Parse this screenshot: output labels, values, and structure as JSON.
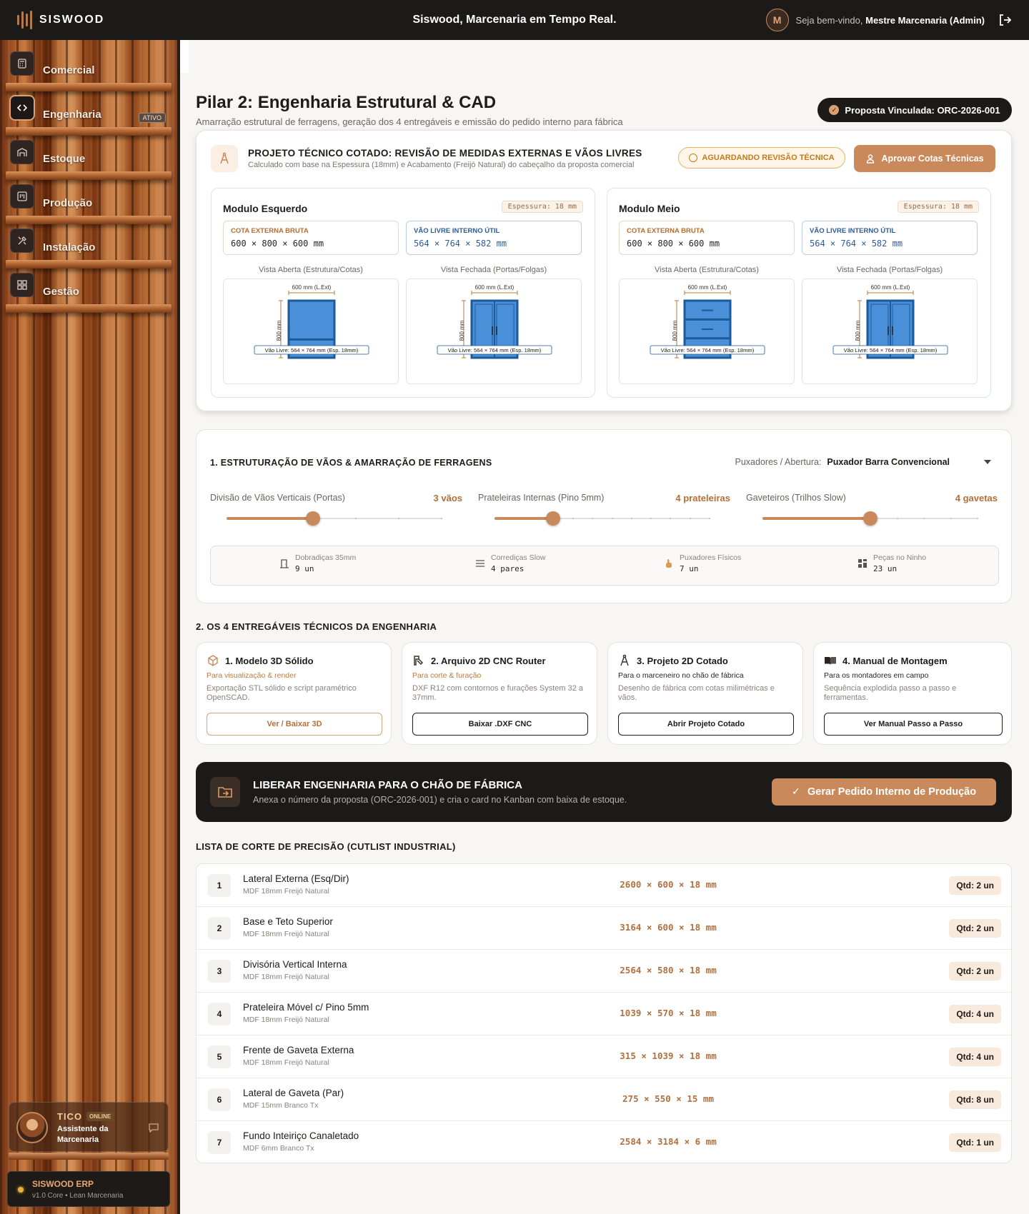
{
  "topbar": {
    "logo": "SISWOOD",
    "title": "Siswood, Marcenaria em Tempo Real.",
    "avatar_initial": "M",
    "welcome": "Seja bem-vindo,",
    "user": "Mestre Marcenaria (Admin)"
  },
  "sidebar": {
    "items": [
      {
        "label": "Comercial",
        "icon": "calculator-icon"
      },
      {
        "label": "Engenharia",
        "icon": "code-icon",
        "active": true,
        "badge": "ATIVO"
      },
      {
        "label": "Estoque",
        "icon": "warehouse-icon"
      },
      {
        "label": "Produção",
        "icon": "kanban-icon"
      },
      {
        "label": "Instalação",
        "icon": "tools-icon"
      },
      {
        "label": "Gestão",
        "icon": "dashboard-icon"
      }
    ],
    "assistant": {
      "name": "TICO",
      "status": "ONLINE",
      "subtitle": "Assistente da Marcenaria"
    },
    "erp": {
      "name": "SISWOOD ERP",
      "version": "v1.0 Core • Lean Marcenaria"
    }
  },
  "header": {
    "title": "Pilar 2: Engenharia Estrutural & CAD",
    "subtitle": "Amarração estrutural de ferragens, geração dos 4 entregáveis e emissão do pedido interno para fábrica",
    "proposal": "Proposta Vinculada: ORC-2026-001"
  },
  "project": {
    "title": "PROJETO TÉCNICO COTADO: REVISÃO DE MEDIDAS EXTERNAS E VÃOS LIVRES",
    "subtitle": "Calculado com base na Espessura (18mm) e Acabamento (Freijó Natural) do cabeçalho da proposta comercial",
    "status": "AGUARDANDO REVISÃO TÉCNICA",
    "approve_label": "Aprovar Cotas Técnicas",
    "cota_ext_label": "COTA EXTERNA BRUTA",
    "vao_label": "VÃO LIVRE INTERNO ÚTIL",
    "vista_aberta": "Vista Aberta (Estrutura/Cotas)",
    "vista_fechada": "Vista Fechada (Portas/Folgas)",
    "width_label": "600 mm (L.Ext)",
    "height_label": "800 mm",
    "vao_caption": "Vão Livre: 564 × 764 mm (Esp. 18mm)",
    "modules": [
      {
        "name": "Modulo Esquerdo",
        "espessura": "Espessura: 18 mm",
        "cota_ext": "600 × 800 × 600 mm",
        "vao": "564 × 764 × 582 mm",
        "open_type": "shelf"
      },
      {
        "name": "Modulo Meio",
        "espessura": "Espessura: 18 mm",
        "cota_ext": "600 × 800 × 600 mm",
        "vao": "564 × 764 × 582 mm",
        "open_type": "drawers"
      }
    ],
    "colors": {
      "blue": "#4a90d9",
      "frame": "#1d5a9a",
      "wood": "#b5793f"
    }
  },
  "structure": {
    "title": "1. ESTRUTURAÇÃO DE VÃOS & AMARRAÇÃO DE FERRAGENS",
    "puxadores_label": "Puxadores / Abertura:",
    "puxadores_value": "Puxador Barra Convencional",
    "sliders": [
      {
        "label": "Divisão de Vãos Verticais (Portas)",
        "value_text": "3 vãos",
        "value": 3,
        "min": 1,
        "max": 6
      },
      {
        "label": "Prateleiras Internas (Pino 5mm)",
        "value_text": "4 prateleiras",
        "value": 4,
        "min": 1,
        "max": 12
      },
      {
        "label": "Gaveteiros (Trilhos Slow)",
        "value_text": "4 gavetas",
        "value": 4,
        "min": 0,
        "max": 8
      }
    ],
    "hardware": [
      {
        "label": "Dobradiças 35mm",
        "value": "9 un",
        "icon": "door-icon"
      },
      {
        "label": "Corrediças Slow",
        "value": "4 pares",
        "icon": "rails-icon"
      },
      {
        "label": "Puxadores Físicos",
        "value": "7 un",
        "icon": "hand-icon"
      },
      {
        "label": "Peças no Ninho",
        "value": "23 un",
        "icon": "grid-icon"
      }
    ]
  },
  "deliverables": {
    "title": "2. OS 4 ENTREGÁVEIS TÉCNICOS DA ENGENHARIA",
    "items": [
      {
        "title": "1. Modelo 3D Sólido",
        "tag": "Para visualização & render",
        "desc": "Exportação STL sólido e script paramétrico OpenSCAD.",
        "button": "Ver / Baixar 3D"
      },
      {
        "title": "2. Arquivo 2D CNC Router",
        "tag": "Para corte & furação",
        "desc": "DXF R12 com contornos e furações System 32 a 37mm.",
        "button": "Baixar .DXF CNC"
      },
      {
        "title": "3. Projeto 2D Cotado",
        "tag": "Para o marceneiro no chão de fábrica",
        "desc": "Desenho de fábrica com cotas milimétricas e vãos.",
        "button": "Abrir Projeto Cotado"
      },
      {
        "title": "4. Manual de Montagem",
        "tag": "Para os montadores em campo",
        "desc": "Sequência explodida passo a passo e ferramentas.",
        "button": "Ver Manual Passo a Passo"
      }
    ]
  },
  "release": {
    "title": "LIBERAR ENGENHARIA PARA O CHÃO DE FÁBRICA",
    "subtitle": "Anexa o número da proposta (ORC-2026-001) e cria o card no Kanban com baixa de estoque.",
    "button": "Gerar Pedido Interno de Produção"
  },
  "cutlist": {
    "title": "LISTA DE CORTE DE PRECISÃO (CUTLIST INDUSTRIAL)",
    "rows": [
      {
        "n": "1",
        "name": "Lateral Externa (Esq/Dir)",
        "material": "MDF 18mm Freijó Natural",
        "dim": "2600 × 600 × 18 mm",
        "qty": "Qtd: 2 un"
      },
      {
        "n": "2",
        "name": "Base e Teto Superior",
        "material": "MDF 18mm Freijó Natural",
        "dim": "3164 × 600 × 18 mm",
        "qty": "Qtd: 2 un"
      },
      {
        "n": "3",
        "name": "Divisória Vertical Interna",
        "material": "MDF 18mm Freijó Natural",
        "dim": "2564 × 580 × 18 mm",
        "qty": "Qtd: 2 un"
      },
      {
        "n": "4",
        "name": "Prateleira Móvel c/ Pino 5mm",
        "material": "MDF 18mm Freijó Natural",
        "dim": "1039 × 570 × 18 mm",
        "qty": "Qtd: 4 un"
      },
      {
        "n": "5",
        "name": "Frente de Gaveta Externa",
        "material": "MDF 18mm Freijó Natural",
        "dim": "315 × 1039 × 18 mm",
        "qty": "Qtd: 4 un"
      },
      {
        "n": "6",
        "name": "Lateral de Gaveta (Par)",
        "material": "MDF 15mm Branco Tx",
        "dim": "275 × 550 × 15 mm",
        "qty": "Qtd: 8 un"
      },
      {
        "n": "7",
        "name": "Fundo Inteiriço Canaletado",
        "material": "MDF 6mm Branco Tx",
        "dim": "2584 × 3184 × 6 mm",
        "qty": "Qtd: 1 un"
      }
    ]
  }
}
